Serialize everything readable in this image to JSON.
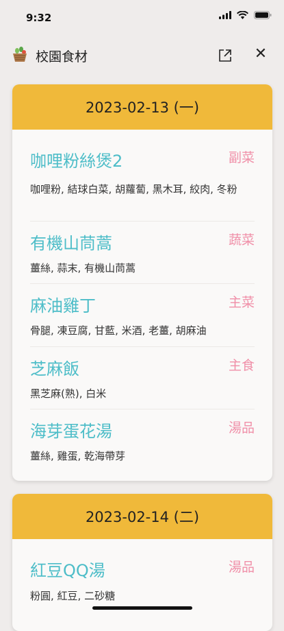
{
  "status": {
    "time": "9:32"
  },
  "app": {
    "title": "校園食材"
  },
  "days": [
    {
      "date": "2023-02-13 (一)",
      "dishes": [
        {
          "name": "咖哩粉絲煲2",
          "category": "副菜",
          "ingredients": "咖哩粉, 結球白菜, 胡蘿蔔, 黑木耳, 絞肉, 冬粉"
        },
        {
          "name": "有機山茼蒿",
          "category": "蔬菜",
          "ingredients": "薑絲, 蒜末, 有機山茼蒿"
        },
        {
          "name": "麻油雞丁",
          "category": "主菜",
          "ingredients": "骨腿, 凍豆腐, 甘藍, 米酒, 老薑, 胡麻油"
        },
        {
          "name": "芝麻飯",
          "category": "主食",
          "ingredients": "黑芝麻(熟), 白米"
        },
        {
          "name": "海芽蛋花湯",
          "category": "湯品",
          "ingredients": "薑絲, 雞蛋, 乾海帶芽"
        }
      ]
    },
    {
      "date": "2023-02-14 (二)",
      "dishes": [
        {
          "name": "紅豆QQ湯",
          "category": "湯品",
          "ingredients": "粉圓, 紅豆, 二砂糖"
        }
      ]
    }
  ],
  "colors": {
    "header": "#f0b93a",
    "dish_name": "#4dbdc8",
    "category": "#f08fa8",
    "background": "#efeceb"
  }
}
